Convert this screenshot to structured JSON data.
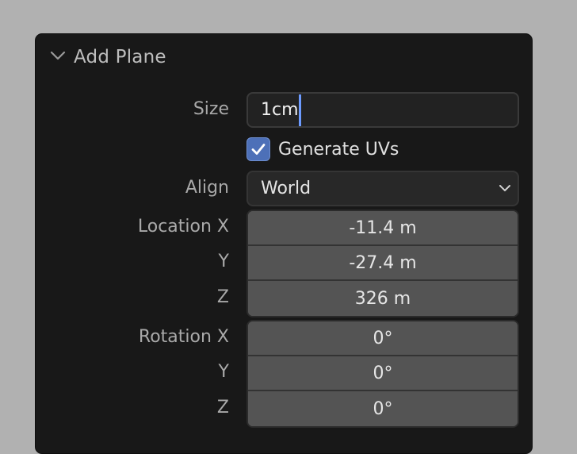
{
  "panel": {
    "title": "Add Plane"
  },
  "size": {
    "label": "Size",
    "value": "1cm"
  },
  "generate_uvs": {
    "label": "Generate UVs",
    "checked": true
  },
  "align": {
    "label": "Align",
    "value": "World"
  },
  "location": {
    "label_x": "Location X",
    "label_y": "Y",
    "label_z": "Z",
    "x": "-11.4 m",
    "y": "-27.4 m",
    "z": "326 m"
  },
  "rotation": {
    "label_x": "Rotation X",
    "label_y": "Y",
    "label_z": "Z",
    "x": "0°",
    "y": "0°",
    "z": "0°"
  },
  "colors": {
    "background": "#b1b1b1",
    "panel": "#181818",
    "accent": "#4d70b8",
    "caret": "#6d9bff"
  },
  "icons": {
    "collapse": "chevron-down-icon",
    "check": "checkmark-icon",
    "dropdown": "chevron-down-icon"
  }
}
